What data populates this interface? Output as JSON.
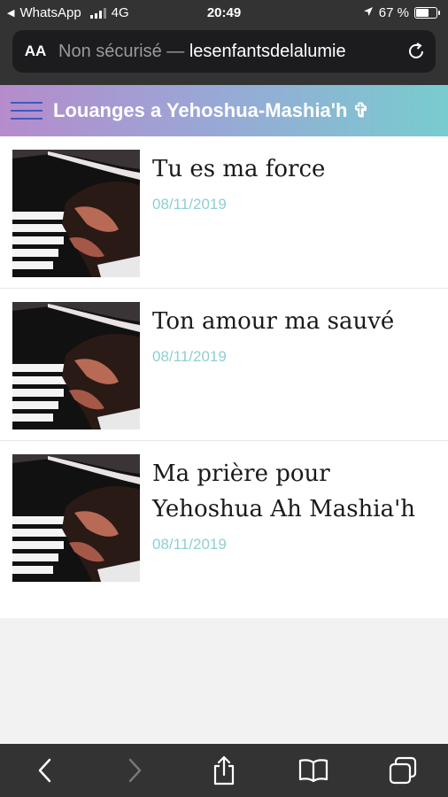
{
  "status_bar": {
    "back_app": "WhatsApp",
    "network": "4G",
    "time": "20:49",
    "battery": "67 %",
    "battery_level": 0.67
  },
  "browser": {
    "aa_label": "AA",
    "security_label": "Non sécurisé —",
    "domain": "lesenfantsdelalumie"
  },
  "site": {
    "title": "Louanges a Yehoshua-Mashia'h ✞"
  },
  "posts": [
    {
      "title": "Tu es ma force",
      "date": "08/11/2019"
    },
    {
      "title": "Ton amour ma sauvé",
      "date": "08/11/2019"
    },
    {
      "title": "Ma prière pour Yehoshua Ah Mashia'h",
      "date": "08/11/2019"
    }
  ],
  "icons": {
    "back": "chevron-left-icon",
    "forward": "chevron-right-icon",
    "share": "share-icon",
    "bookmarks": "book-icon",
    "tabs": "tabs-icon"
  }
}
